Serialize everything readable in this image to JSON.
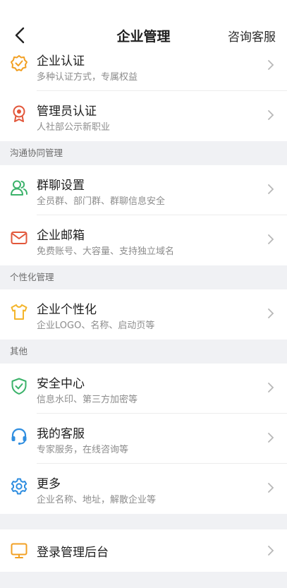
{
  "header": {
    "title": "企业管理",
    "consult_label": "咨询客服"
  },
  "colors": {
    "orange": "#f2a024",
    "red": "#e2563a",
    "green": "#3bb26a",
    "blue": "#2f8ee0",
    "gold": "#f4b52b"
  },
  "top_items": [
    {
      "title": "企业认证",
      "desc": "多种认证方式，专属权益",
      "icon": "verified-badge-icon"
    },
    {
      "title": "管理员认证",
      "desc": "人社部公示新职业",
      "icon": "medal-icon"
    }
  ],
  "sections": [
    {
      "label": "沟通协同管理",
      "items": [
        {
          "title": "群聊设置",
          "desc": "全员群、部门群、群聊信息安全",
          "icon": "group-chat-icon"
        },
        {
          "title": "企业邮箱",
          "desc": "免费账号、大容量、支持独立域名",
          "icon": "mail-icon"
        }
      ]
    },
    {
      "label": "个性化管理",
      "items": [
        {
          "title": "企业个性化",
          "desc": "企业LOGO、名称、启动页等",
          "icon": "tshirt-icon"
        }
      ]
    },
    {
      "label": "其他",
      "items": [
        {
          "title": "安全中心",
          "desc": "信息水印、第三方加密等",
          "icon": "shield-icon"
        },
        {
          "title": "我的客服",
          "desc": "专家服务，在线咨询等",
          "icon": "headset-icon"
        },
        {
          "title": "更多",
          "desc": "企业名称、地址，解散企业等",
          "icon": "gear-icon"
        }
      ]
    }
  ],
  "bottom_item": {
    "title": "登录管理后台",
    "icon": "monitor-icon"
  }
}
